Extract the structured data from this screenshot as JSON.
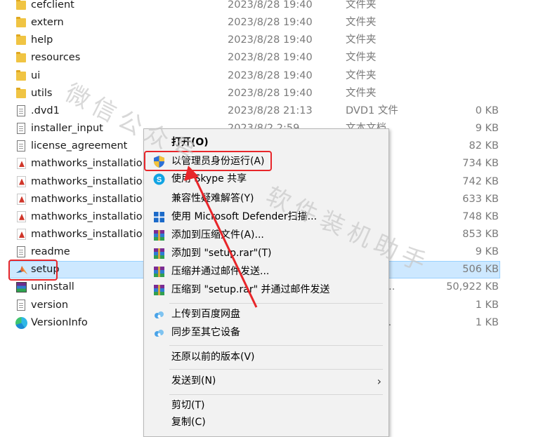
{
  "files": [
    {
      "name": "cefclient",
      "date": "2023/8/28 19:40",
      "type": "文件夹",
      "size": "",
      "icon": "folder-icon"
    },
    {
      "name": "extern",
      "date": "2023/8/28 19:40",
      "type": "文件夹",
      "size": "",
      "icon": "folder-icon"
    },
    {
      "name": "help",
      "date": "2023/8/28 19:40",
      "type": "文件夹",
      "size": "",
      "icon": "folder-icon"
    },
    {
      "name": "resources",
      "date": "2023/8/28 19:40",
      "type": "文件夹",
      "size": "",
      "icon": "folder-icon"
    },
    {
      "name": "ui",
      "date": "2023/8/28 19:40",
      "type": "文件夹",
      "size": "",
      "icon": "folder-icon"
    },
    {
      "name": "utils",
      "date": "2023/8/28 19:40",
      "type": "文件夹",
      "size": "",
      "icon": "folder-icon"
    },
    {
      "name": ".dvd1",
      "date": "2023/8/28 21:13",
      "type": "DVD1 文件",
      "size": "0 KB",
      "icon": "document-icon"
    },
    {
      "name": "installer_input",
      "date": "2023/8/2 2:59",
      "type": "文本文档",
      "size": "9 KB",
      "icon": "document-icon"
    },
    {
      "name": "license_agreement",
      "date": "",
      "type": "",
      "size": "82 KB",
      "icon": "document-icon"
    },
    {
      "name": "mathworks_installation_",
      "date": "",
      "type": "",
      "size": "734 KB",
      "icon": "pdf-icon"
    },
    {
      "name": "mathworks_installation_",
      "date": "",
      "type": "",
      "size": "742 KB",
      "icon": "pdf-icon"
    },
    {
      "name": "mathworks_installation_",
      "date": "",
      "type": "",
      "size": "633 KB",
      "icon": "pdf-icon"
    },
    {
      "name": "mathworks_installation_",
      "date": "",
      "type": "",
      "size": "748 KB",
      "icon": "pdf-icon"
    },
    {
      "name": "mathworks_installation_",
      "date": "",
      "type": "",
      "size": "853 KB",
      "icon": "pdf-icon"
    },
    {
      "name": "readme",
      "date": "",
      "type": "",
      "size": "9 KB",
      "icon": "document-icon"
    },
    {
      "name": "setup",
      "date": "",
      "type": "",
      "size": "506 KB",
      "icon": "matlab-icon",
      "selected": true
    },
    {
      "name": "uninstall",
      "date": "",
      "type": "ZIP 压缩...",
      "size": "50,922 KB",
      "icon": "rar-icon"
    },
    {
      "name": "version",
      "date": "",
      "type": "",
      "size": "1 KB",
      "icon": "document-icon"
    },
    {
      "name": "VersionInfo",
      "date": "",
      "type": "t Edge ...",
      "size": "1 KB",
      "icon": "edge-icon"
    }
  ],
  "context_menu": {
    "items": [
      {
        "label": "打开(O)",
        "icon": "",
        "bold": true
      },
      {
        "label": "以管理员身份运行(A)",
        "icon": "uac-shield-icon"
      },
      {
        "label": "使用 Skype 共享",
        "icon": "skype-icon"
      },
      {
        "label": "兼容性疑难解答(Y)",
        "icon": ""
      },
      {
        "label": "使用 Microsoft Defender扫描...",
        "icon": "defender-icon"
      },
      {
        "label": "添加到压缩文件(A)...",
        "icon": "winrar-icon"
      },
      {
        "label": "添加到 \"setup.rar\"(T)",
        "icon": "winrar-icon"
      },
      {
        "label": "压缩并通过邮件发送...",
        "icon": "winrar-icon"
      },
      {
        "label": "压缩到 \"setup.rar\" 并通过邮件发送",
        "icon": "winrar-icon"
      },
      {
        "label": "上传到百度网盘",
        "icon": "baidu-cloud-icon"
      },
      {
        "label": "同步至其它设备",
        "icon": "baidu-cloud-icon"
      },
      {
        "label": "还原以前的版本(V)",
        "icon": ""
      },
      {
        "label": "发送到(N)",
        "icon": "",
        "submenu": true
      },
      {
        "label": "剪切(T)",
        "icon": ""
      },
      {
        "label": "复制(C)",
        "icon": ""
      }
    ],
    "submenu_arrow": "›"
  },
  "watermark": {
    "line1": "微信公众号",
    "line2": "软件装机助手"
  },
  "colors": {
    "highlight": "#e8262a",
    "selection": "#cde8ff",
    "arrow": "#e8262a"
  }
}
